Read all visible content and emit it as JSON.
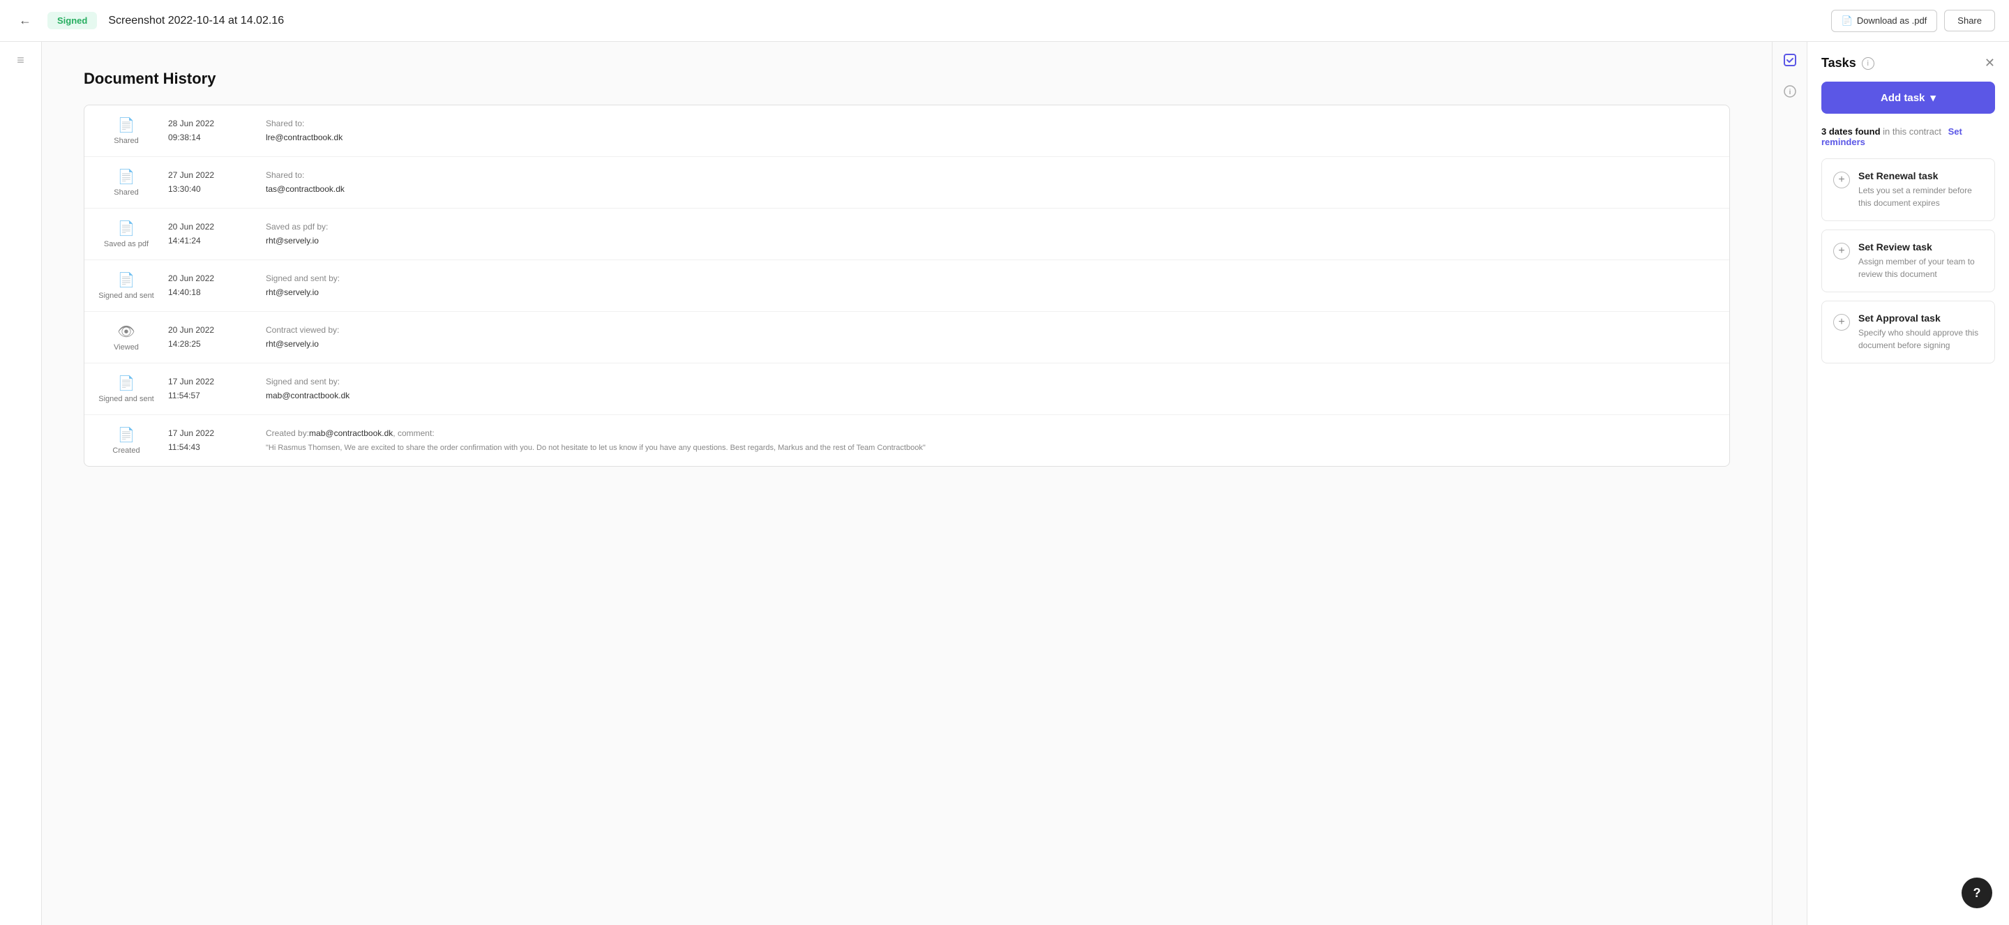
{
  "topbar": {
    "back_icon": "←",
    "signed_badge": "Signed",
    "doc_title": "Screenshot 2022-10-14 at 14.02.16",
    "download_label": "Download as .pdf",
    "share_label": "Share"
  },
  "history": {
    "title": "Document History",
    "rows": [
      {
        "icon": "📄",
        "icon_color": "",
        "label": "Shared",
        "date": "28 Jun 2022",
        "time": "09:38:14",
        "action": "Shared to:",
        "person": "lre@contractbook.dk"
      },
      {
        "icon": "📄",
        "icon_color": "",
        "label": "Shared",
        "date": "27 Jun 2022",
        "time": "13:30:40",
        "action": "Shared to:",
        "person": "tas@contractbook.dk"
      },
      {
        "icon": "📄",
        "icon_color": "",
        "label": "Saved as pdf",
        "date": "20 Jun 2022",
        "time": "14:41:24",
        "action": "Saved as pdf by:",
        "person": "rht@servely.io"
      },
      {
        "icon": "📄",
        "icon_color": "green",
        "label": "Signed and sent",
        "date": "20 Jun 2022",
        "time": "14:40:18",
        "action": "Signed and sent by:",
        "person": "rht@servely.io"
      },
      {
        "icon": "👁",
        "icon_color": "",
        "label": "Viewed",
        "date": "20 Jun 2022",
        "time": "14:28:25",
        "action": "Contract viewed by:",
        "person": "rht@servely.io"
      },
      {
        "icon": "📄",
        "icon_color": "green",
        "label": "Signed and sent",
        "date": "17 Jun 2022",
        "time": "11:54:57",
        "action": "Signed and sent by:",
        "person": "mab@contractbook.dk"
      },
      {
        "icon": "📄",
        "icon_color": "",
        "label": "Created",
        "date": "17 Jun 2022",
        "time": "11:54:43",
        "action": "Created by:",
        "person": "mab@contractbook.dk",
        "comment": ", comment:",
        "comment_text": "\"Hi Rasmus Thomsen, We are excited to share the order confirmation with you. Do not hesitate to let us know if you have any questions. Best regards, Markus and the rest of Team Contractbook\""
      }
    ]
  },
  "panel": {
    "title": "Tasks",
    "dates_found_count": "3 dates found",
    "dates_found_suffix": "in this contract",
    "set_reminders_label": "Set reminders",
    "add_task_label": "Add task",
    "tasks": [
      {
        "title": "Set Renewal task",
        "description": "Lets you set a reminder before this document expires"
      },
      {
        "title": "Set Review task",
        "description": "Assign member of your team to review this document"
      },
      {
        "title": "Set Approval task",
        "description": "Specify who should approve this document before signing"
      }
    ]
  }
}
